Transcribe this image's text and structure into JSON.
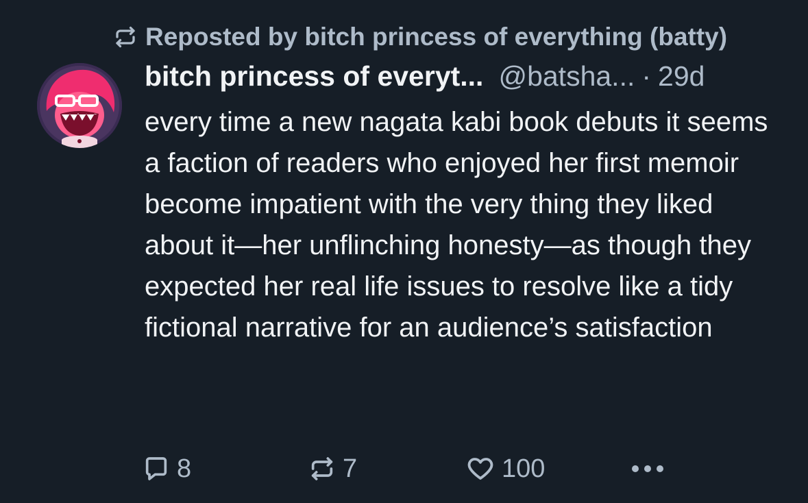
{
  "repost_banner": {
    "icon": "repost-icon",
    "text": "Reposted by bitch princess of everything (batty)"
  },
  "author": {
    "avatar_icon": "avatar",
    "display_name": "bitch princess of everyt...",
    "handle": "@batsha...",
    "separator": "·",
    "time": "29d"
  },
  "post": {
    "text": "every time a new nagata kabi book debuts it seems a faction of readers who enjoyed her first memoir become impatient with the very thing they liked about it—her unflinching honesty—as though they expected her real life issues to resolve like a tidy fictional narrative for an audience’s satisfaction"
  },
  "actions": {
    "reply": {
      "icon": "reply-icon",
      "count": "8"
    },
    "repost": {
      "icon": "repost-icon",
      "count": "7"
    },
    "like": {
      "icon": "heart-icon",
      "count": "100"
    },
    "more": {
      "icon": "more-icon"
    }
  },
  "colors": {
    "background": "#161e27",
    "text_primary": "#f1f3f5",
    "text_secondary": "#aebbc9",
    "avatar_accent": "#ef2d6f"
  }
}
